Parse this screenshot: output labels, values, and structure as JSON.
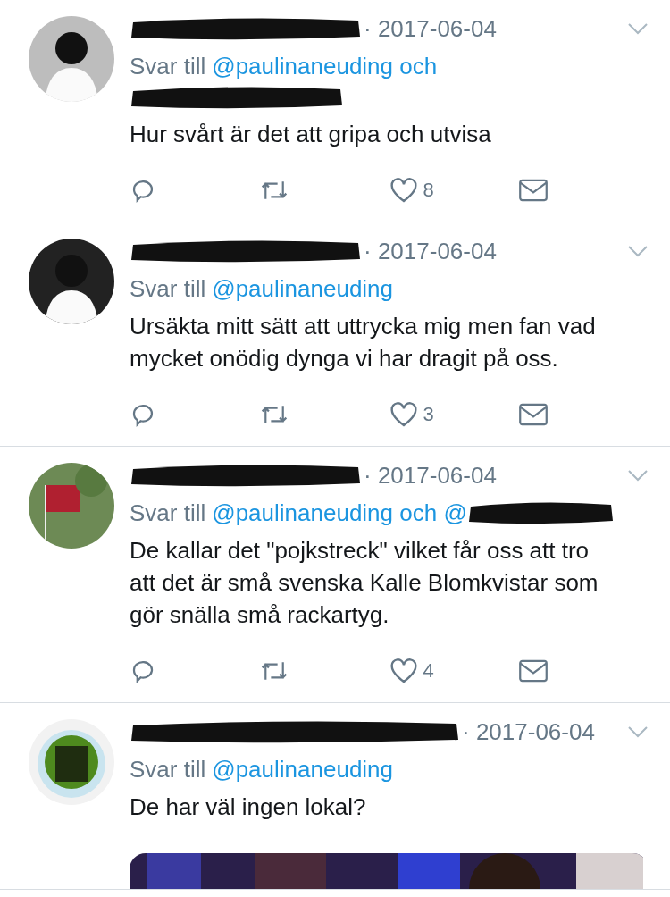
{
  "tweets": [
    {
      "name_redacted": true,
      "date": "· 2017-06-04",
      "reply": {
        "prefix": "Svar till",
        "mentions": "@paulinaneuding och",
        "mention_redacted": true
      },
      "text": "Hur svårt är det att gripa och utvisa",
      "likes": "8"
    },
    {
      "name_redacted": true,
      "date": "· 2017-06-04",
      "reply": {
        "prefix": "Svar till",
        "mentions": "@paulinaneuding",
        "mention_redacted": false
      },
      "text": "Ursäkta mitt sätt att uttrycka mig men fan vad mycket onödig dynga vi har dragit på oss.",
      "likes": "3"
    },
    {
      "name_redacted": true,
      "date": "· 2017-06-04",
      "reply": {
        "prefix": "Svar till",
        "mentions": "@paulinaneuding och @",
        "mention_redacted": true
      },
      "text": "De kallar det \"pojkstreck\" vilket får oss att tro att det är små svenska Kalle Blomkvistar som gör snälla små rackartyg.",
      "likes": "4"
    },
    {
      "name_redacted": true,
      "date": "· 2017-06-04",
      "reply": {
        "prefix": "Svar till",
        "mentions": "@paulinaneuding",
        "mention_redacted": false
      },
      "text": "De har väl ingen lokal?"
    }
  ]
}
